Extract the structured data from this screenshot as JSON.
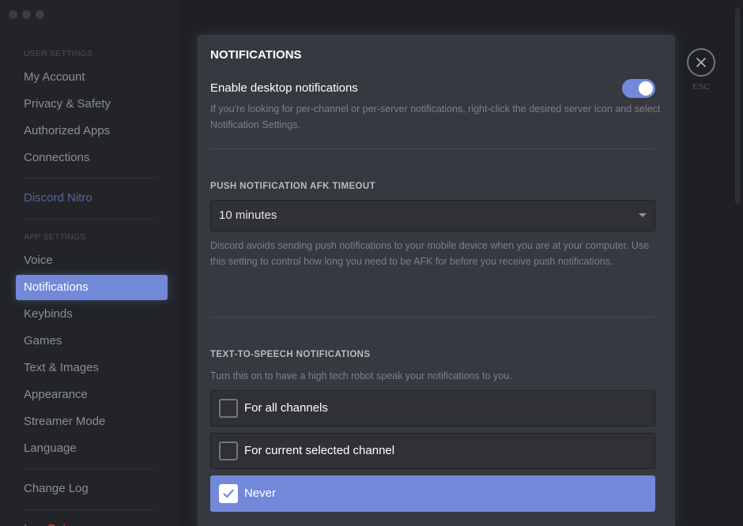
{
  "sidebar": {
    "user_settings_header": "USER SETTINGS",
    "user_items": [
      "My Account",
      "Privacy & Safety",
      "Authorized Apps",
      "Connections"
    ],
    "nitro": "Discord Nitro",
    "app_settings_header": "APP SETTINGS",
    "app_items": [
      "Voice",
      "Notifications",
      "Keybinds",
      "Games",
      "Text & Images",
      "Appearance",
      "Streamer Mode",
      "Language"
    ],
    "active_item": "Notifications",
    "change_log": "Change Log",
    "log_out": "Log Out"
  },
  "panel": {
    "title": "NOTIFICATIONS",
    "desktop": {
      "label": "Enable desktop notifications",
      "enabled": true,
      "description": "If you're looking for per-channel or per-server notifications, right-click the desired server icon and select Notification Settings."
    },
    "afk": {
      "title": "PUSH NOTIFICATION AFK TIMEOUT",
      "selected": "10 minutes",
      "description": "Discord avoids sending push notifications to your mobile device when you are at your computer. Use this setting to control how long you need to be AFK for before you receive push notifications."
    },
    "tts": {
      "title": "TEXT-TO-SPEECH NOTIFICATIONS",
      "description": "Turn this on to have a high tech robot speak your notifications to you.",
      "options": [
        "For all channels",
        "For current selected channel",
        "Never"
      ],
      "selected": "Never"
    }
  },
  "close": {
    "label": "ESC"
  },
  "colors": {
    "accent": "#7289da",
    "panel_bg": "#36393f",
    "sidebar_bg": "#222428",
    "danger": "#f04747"
  },
  "icons": {
    "close": "close-icon",
    "checkmark": "check-icon",
    "dropdown": "chevron-down-icon"
  }
}
